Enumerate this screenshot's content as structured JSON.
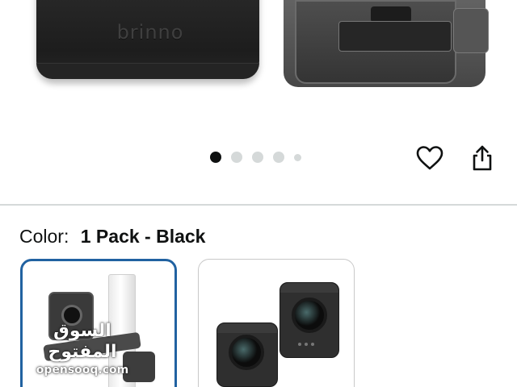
{
  "gallery": {
    "brand_logo_text": "brinno",
    "image_count": 5,
    "active_index": 0
  },
  "actions": {
    "favorite_icon": "heart-outline-icon",
    "share_icon": "share-icon"
  },
  "variation": {
    "label": "Color:",
    "value": "1 Pack - Black",
    "selected_index": 0,
    "swatch_count": 2,
    "selected_border_color": "#2162a1"
  },
  "watermark": {
    "arabic": "السوق المفتوح",
    "latin": "opensooq.com"
  },
  "colors": {
    "text": "#0f1111",
    "divider": "#d5d9d9",
    "dot_active": "#0f1111",
    "dot_inactive": "#d5d9d9"
  }
}
